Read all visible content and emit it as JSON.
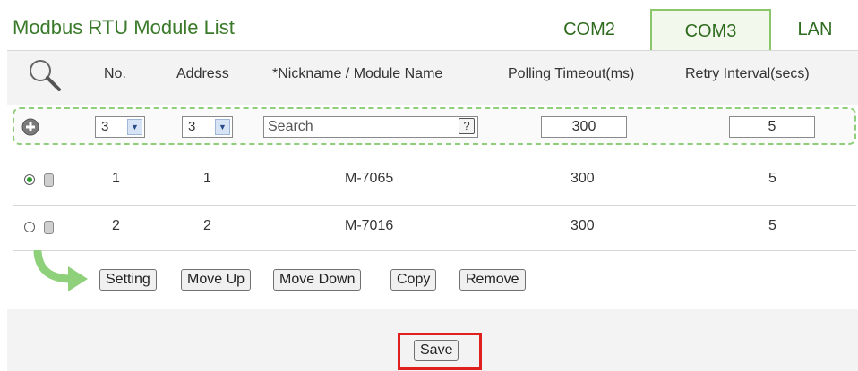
{
  "page": {
    "title": "Modbus RTU Module List"
  },
  "tabs": [
    {
      "label": "COM2",
      "active": false
    },
    {
      "label": "COM3",
      "active": true
    },
    {
      "label": "LAN",
      "active": false
    }
  ],
  "columns": [
    "No.",
    "Address",
    "*Nickname / Module Name",
    "Polling Timeout(ms)",
    "Retry Interval(secs)"
  ],
  "add_row": {
    "no": "3",
    "address": "3",
    "search_placeholder": "Search",
    "help_label": "?",
    "timeout": "300",
    "retry": "5"
  },
  "modules": [
    {
      "selected": true,
      "no": "1",
      "address": "1",
      "name": "M-7065",
      "timeout": "300",
      "retry": "5"
    },
    {
      "selected": false,
      "no": "2",
      "address": "2",
      "name": "M-7016",
      "timeout": "300",
      "retry": "5"
    }
  ],
  "actions": {
    "setting": "Setting",
    "move_up": "Move Up",
    "move_down": "Move Down",
    "copy": "Copy",
    "remove": "Remove"
  },
  "save_label": "Save",
  "colors": {
    "title": "#3a7a2a",
    "tab_active_border": "#8cc66a",
    "add_row_border": "#8fcf7a",
    "highlight": "#e0201f"
  },
  "icons": [
    "magnifier-icon",
    "plus-circle-icon",
    "dropdown-arrow-icon",
    "radio-icon",
    "module-icon",
    "green-curved-arrow-icon"
  ]
}
